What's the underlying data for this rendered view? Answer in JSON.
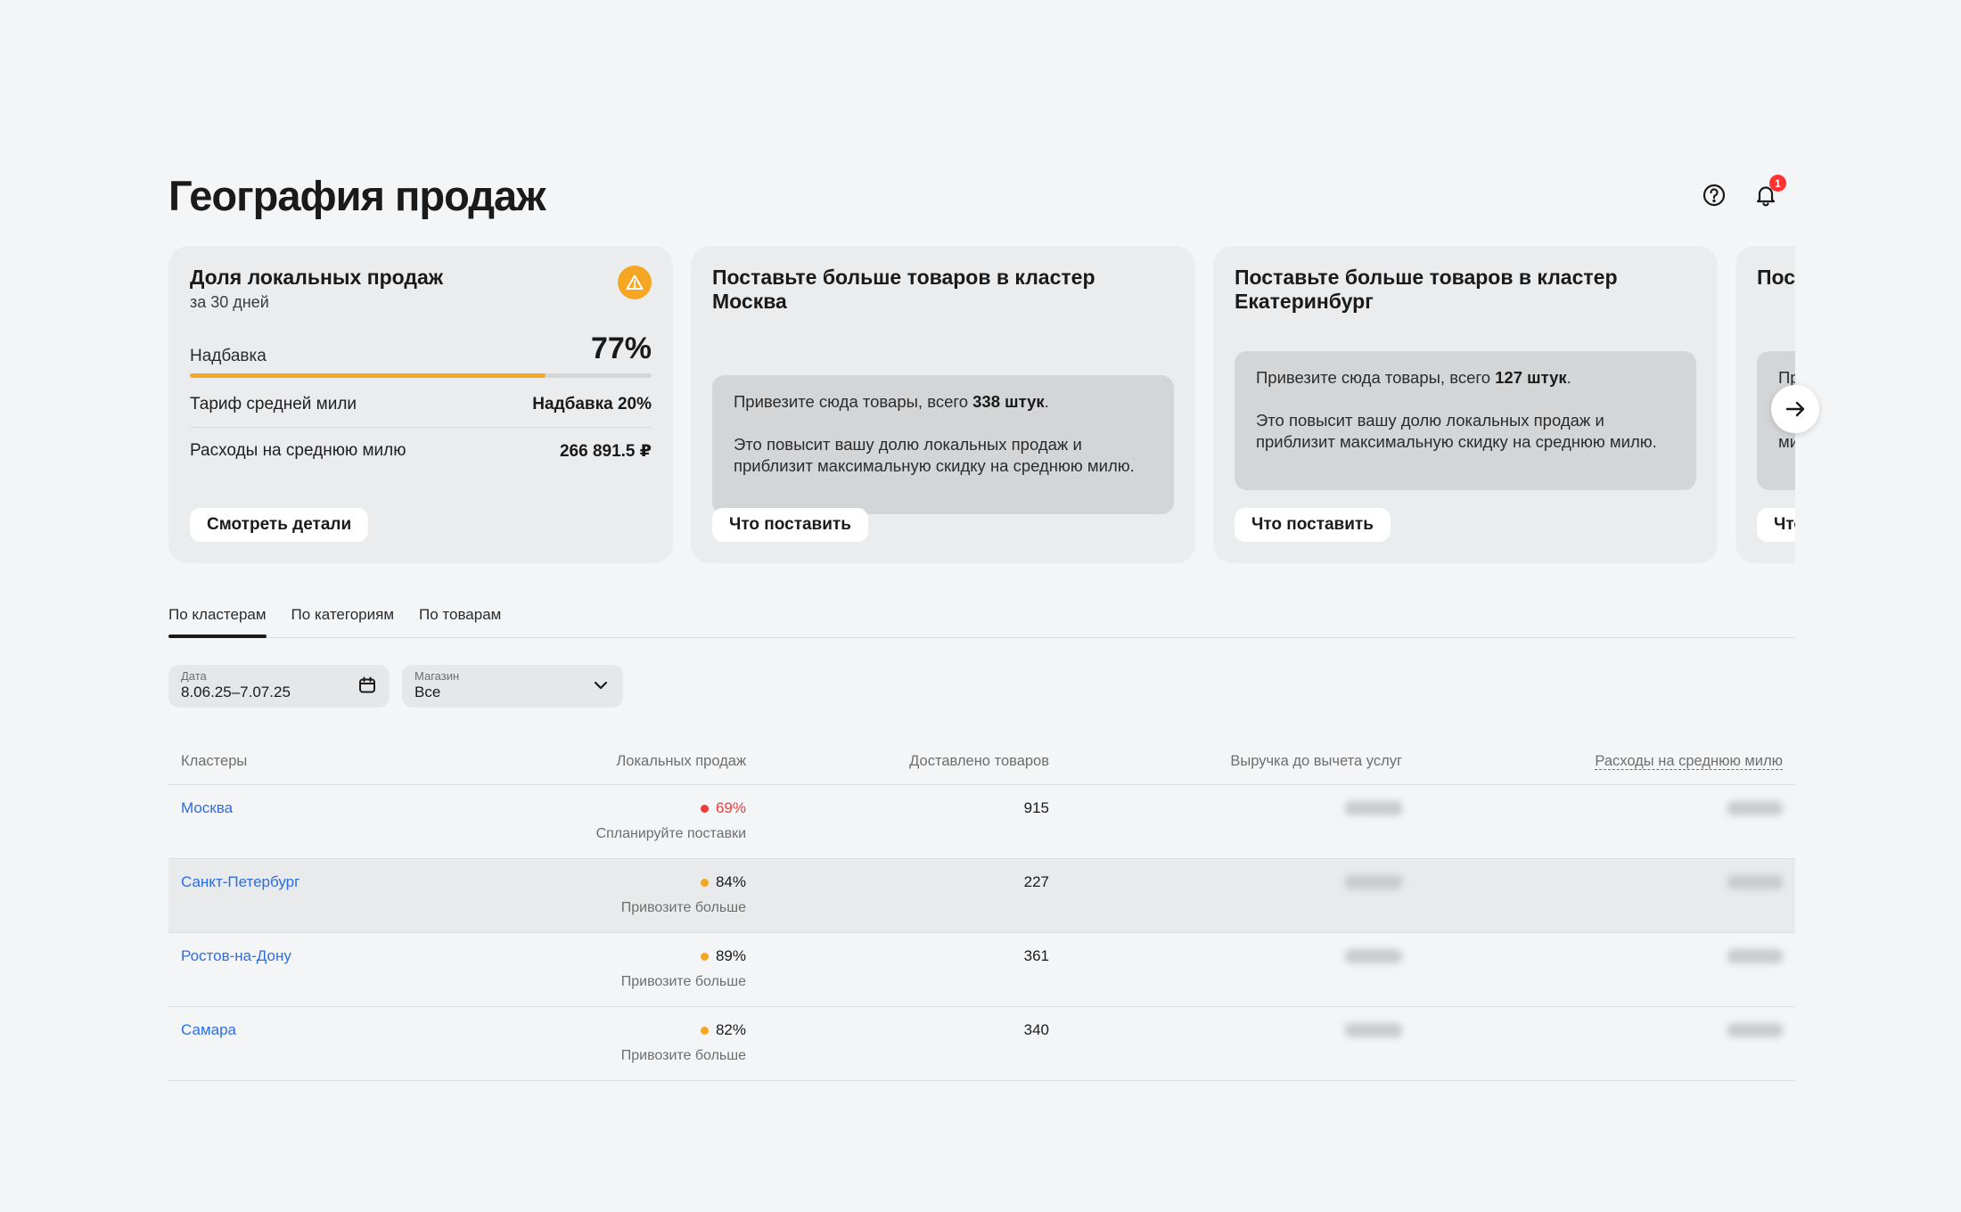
{
  "page": {
    "title": "География продаж"
  },
  "header": {
    "notifications_count": "1",
    "help_icon": "help-circle-icon",
    "bell_icon": "bell-icon"
  },
  "cards": {
    "local_share": {
      "title": "Доля локальных продаж",
      "subtitle": "за 30 дней",
      "metric_label": "Надбавка",
      "metric_value": "77%",
      "progress_fraction": 0.77,
      "rows": [
        {
          "label": "Тариф средней мили",
          "value": "Надбавка 20%"
        },
        {
          "label": "Расходы на среднюю милю",
          "value": "266 891.5 ₽"
        }
      ],
      "button": "Смотреть детали"
    },
    "moscow": {
      "title": "Поставьте больше товаров в кластер Москва",
      "hint_prefix": "Привезите сюда товары, всего ",
      "hint_amount": "338 штук",
      "hint_suffix": ".",
      "hint_body": "Это повысит вашу долю локальных продаж и приблизит максимальную скидку на среднюю милю.",
      "button": "Что поставить"
    },
    "ekb": {
      "title": "Поставьте больше товаров в кластер Екатеринбург",
      "hint_prefix": "Привезите сюда товары, всего ",
      "hint_amount": "127 штук",
      "hint_suffix": ".",
      "hint_body": "Это повысит вашу долю локальных продаж и приблизит максимальную скидку на среднюю милю.",
      "button": "Что поставить"
    },
    "partial": {
      "title": "Пос",
      "hint_line1": "Пр",
      "hint_line2": "и п",
      "hint_line3": "ми",
      "button": "Что"
    }
  },
  "tabs": [
    {
      "label": "По кластерам",
      "active": true
    },
    {
      "label": "По категориям",
      "active": false
    },
    {
      "label": "По товарам",
      "active": false
    }
  ],
  "filters": {
    "date": {
      "label": "Дата",
      "value": "8.06.25–7.07.25"
    },
    "store": {
      "label": "Магазин",
      "value": "Все"
    }
  },
  "table": {
    "columns": [
      "Кластеры",
      "Локальных продаж",
      "Доставлено товаров",
      "Выручка до вычета услуг",
      "Расходы на среднюю милю"
    ],
    "rows": [
      {
        "cluster": "Москва",
        "share": "69%",
        "share_color": "#f23b3b",
        "note": "Спланируйте поставки",
        "delivered": "915",
        "highlight": false
      },
      {
        "cluster": "Санкт-Петербург",
        "share": "84%",
        "share_color": "#f5a623",
        "note": "Привозите больше",
        "delivered": "227",
        "highlight": true
      },
      {
        "cluster": "Ростов-на-Дону",
        "share": "89%",
        "share_color": "#f5a623",
        "note": "Привозите больше",
        "delivered": "361",
        "highlight": false
      },
      {
        "cluster": "Самара",
        "share": "82%",
        "share_color": "#f5a623",
        "note": "Привозите больше",
        "delivered": "340",
        "highlight": false
      }
    ]
  },
  "colors": {
    "accent": "#f5a623",
    "danger": "#f23b3b",
    "link": "#2d6de0"
  }
}
